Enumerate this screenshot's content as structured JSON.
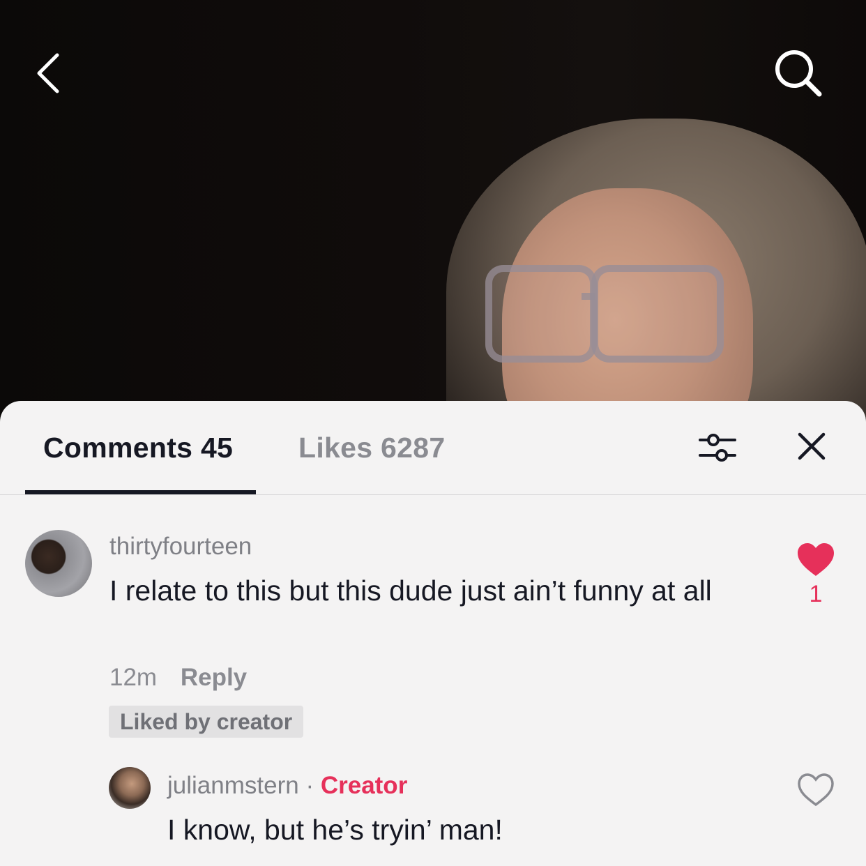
{
  "header": {
    "back_icon": "chevron-left-icon",
    "search_icon": "search-icon"
  },
  "tabs": [
    {
      "label": "Comments 45",
      "active": true
    },
    {
      "label": "Likes 6287",
      "active": false
    }
  ],
  "controls": {
    "filter_icon": "sliders-icon",
    "close_icon": "close-icon"
  },
  "comments": [
    {
      "username": "thirtyfourteen",
      "text": "I relate to this but this dude just ain’t funny at all",
      "time": "12m",
      "reply_label": "Reply",
      "badge": "Liked by creator",
      "likes": "1",
      "liked": true
    },
    {
      "username": "julianmstern",
      "separator": "·",
      "role": "Creator",
      "text": "I know, but he’s tryin’ man!",
      "liked": false
    }
  ],
  "colors": {
    "accent": "#e6305a",
    "text_primary": "#161823",
    "text_secondary": "#8a8b91",
    "sheet_bg": "#f4f3f3"
  }
}
